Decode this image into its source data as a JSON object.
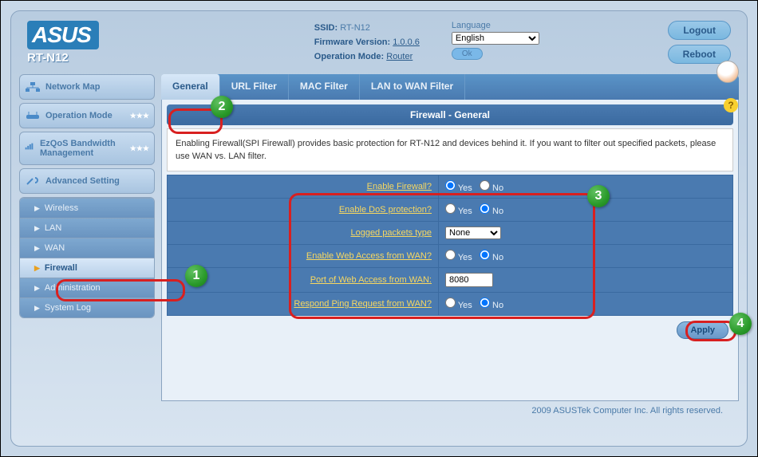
{
  "brand": "ASUS",
  "model": "RT-N12",
  "header": {
    "ssid_label": "SSID:",
    "ssid_value": "RT-N12",
    "fw_label": "Firmware Version:",
    "fw_value": "1.0.0.6",
    "mode_label": "Operation Mode:",
    "mode_value": "Router",
    "lang_label": "Language",
    "lang_value": "English",
    "ok": "Ok",
    "logout": "Logout",
    "reboot": "Reboot"
  },
  "sidebar": {
    "main": [
      "Network Map",
      "Operation Mode",
      "EzQoS Bandwidth Management",
      "Advanced Setting"
    ],
    "sub": [
      "Wireless",
      "LAN",
      "WAN",
      "Firewall",
      "Administration",
      "System Log"
    ]
  },
  "tabs": [
    "General",
    "URL Filter",
    "MAC Filter",
    "LAN to WAN Filter"
  ],
  "panel": {
    "title": "Firewall - General",
    "desc": "Enabling Firewall(SPI Firewall) provides basic protection for RT-N12 and devices behind it. If you want to filter out specified packets, please use WAN vs. LAN filter.",
    "rows": {
      "enable_fw": "Enable Firewall?",
      "enable_dos": "Enable DoS protection?",
      "logged": "Logged packets type",
      "web_wan": "Enable Web Access from WAN?",
      "port_wan": "Port of Web Access from WAN:",
      "ping_wan": "Respond Ping Request from WAN?"
    },
    "yes": "Yes",
    "no": "No",
    "none": "None",
    "port": "8080",
    "apply": "Apply"
  },
  "footer": "2009 ASUSTek Computer Inc. All rights reserved.",
  "badges": [
    "1",
    "2",
    "3",
    "4"
  ]
}
